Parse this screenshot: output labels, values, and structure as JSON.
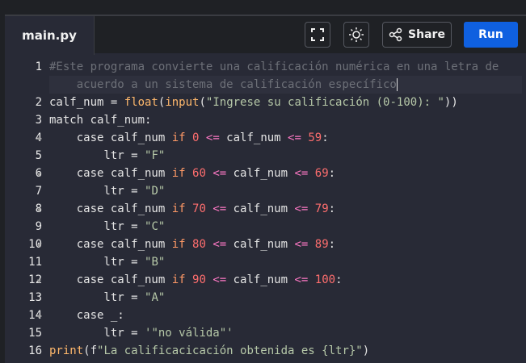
{
  "file_tab": "main.py",
  "toolbar": {
    "fullscreen_icon": "fullscreen-icon",
    "theme_icon": "sun-icon",
    "share_label": "Share",
    "run_label": "Run"
  },
  "code": {
    "lines": [
      {
        "n": "1",
        "t": "#Este programa convierte una calificación numérica en una letra de"
      },
      {
        "n": "",
        "t": "    acuerdo a un sistema de calificación específico"
      },
      {
        "n": "2",
        "t": "calf_num = float(input(\"Ingrese su calificación (0-100): \"))"
      },
      {
        "n": "3",
        "t": "match calf_num:"
      },
      {
        "n": "4",
        "t": "    case calf_num if 0 <= calf_num <= 59:"
      },
      {
        "n": "5",
        "t": "        ltr = \"F\""
      },
      {
        "n": "6",
        "t": "    case calf_num if 60 <= calf_num <= 69:"
      },
      {
        "n": "7",
        "t": "        ltr = \"D\""
      },
      {
        "n": "8",
        "t": "    case calf_num if 70 <= calf_num <= 79:"
      },
      {
        "n": "9",
        "t": "        ltr = \"C\""
      },
      {
        "n": "10",
        "t": "    case calf_num if 80 <= calf_num <= 89:"
      },
      {
        "n": "11",
        "t": "        ltr = \"B\""
      },
      {
        "n": "12",
        "t": "    case calf_num if 90 <= calf_num <= 100:"
      },
      {
        "n": "13",
        "t": "        ltr = \"A\""
      },
      {
        "n": "14",
        "t": "    case _:"
      },
      {
        "n": "15",
        "t": "        ltr = '\"no válida\"'"
      },
      {
        "n": "16",
        "t": "print(f\"La calificacicación obtenida es {ltr}\")"
      }
    ]
  }
}
